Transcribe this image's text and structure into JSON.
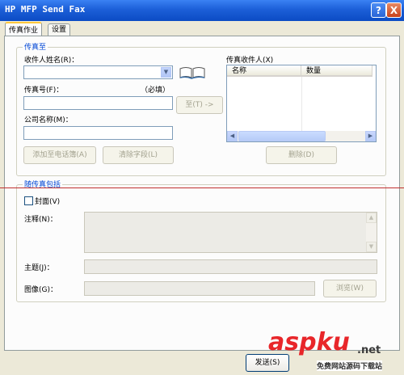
{
  "window": {
    "title": "HP MFP Send Fax"
  },
  "titlebar_buttons": {
    "help": "?",
    "close": "X"
  },
  "tabs": [
    {
      "label": "传真作业"
    },
    {
      "label": "设置"
    }
  ],
  "send_to": {
    "group_label": "传真至",
    "recipient_name_label": "收件人姓名(R)：",
    "recipient_name_value": "",
    "fax_number_label": "传真号(F)：",
    "fax_number_required": "（必填）",
    "fax_number_value": "",
    "company_label": "公司名称(M)：",
    "company_value": "",
    "to_button": "至(T) ->",
    "add_to_phonebook_button": "添加至电话簿(A)",
    "clear_fields_button": "清除字段(L)",
    "recipients_list_label": "传真收件人(X)",
    "columns": [
      "名称",
      "数量"
    ],
    "delete_button": "删除(D)"
  },
  "include": {
    "group_label": "随传真包括",
    "cover_label": "封面(V)",
    "cover_checked": false,
    "notes_label": "注释(N)：",
    "notes_value": "",
    "subject_label": "主题(J)：",
    "subject_value": "",
    "image_label": "图像(G)：",
    "image_value": "",
    "browse_button": "浏览(W)"
  },
  "footer": {
    "send_button": "发送(S)"
  },
  "watermark": {
    "brand": "aspku",
    "suffix": ".net",
    "caption": "免费网站源码下载站"
  },
  "colors": {
    "titlebar": "#0b4bc4",
    "group_label": "#0046d5",
    "watermark_red": "#e8262a"
  }
}
